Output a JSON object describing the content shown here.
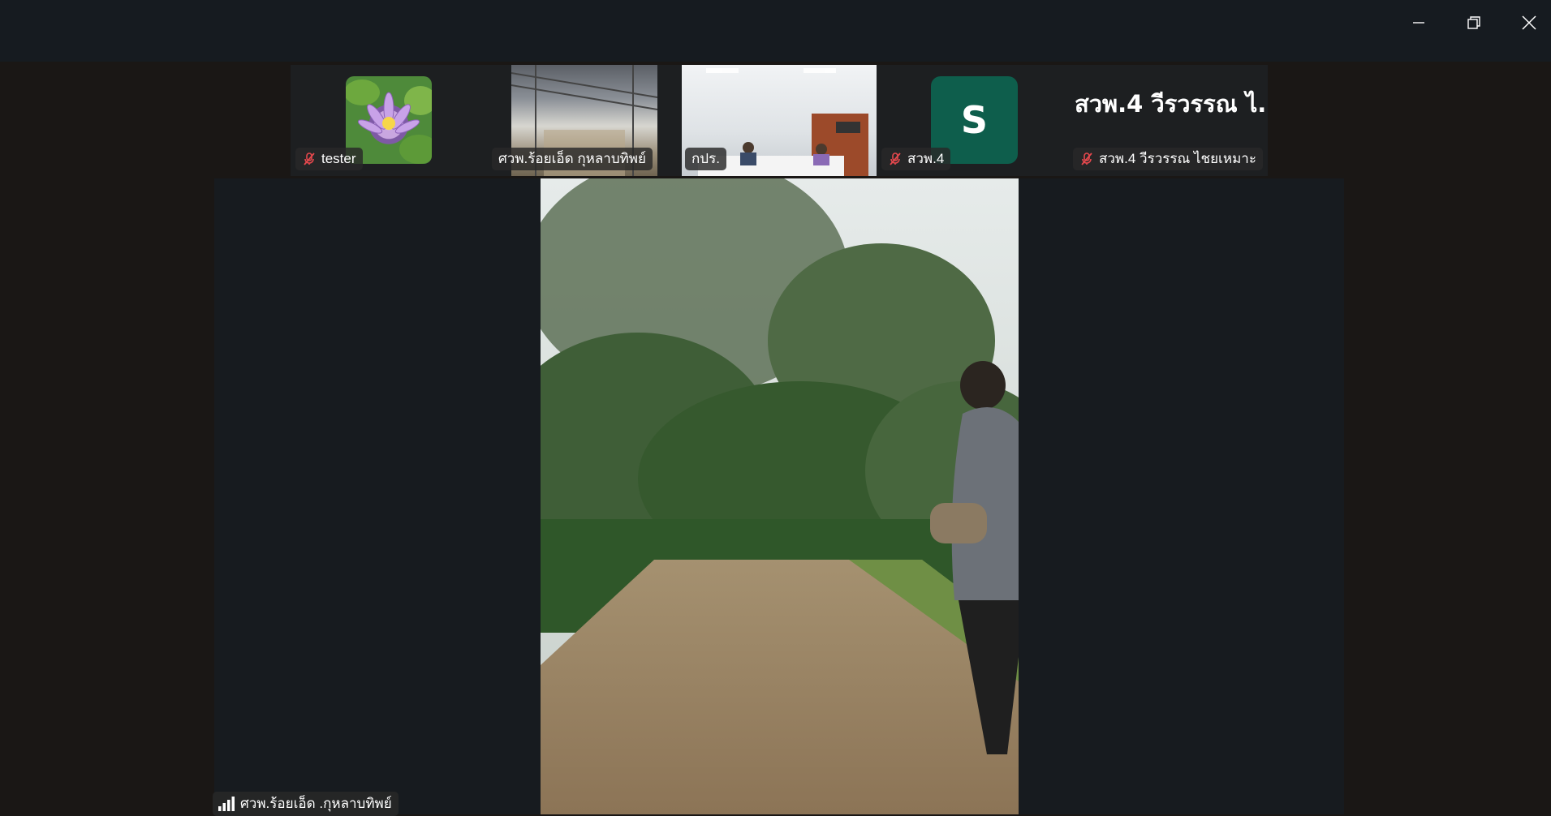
{
  "window": {
    "minimize_icon": "minimize-icon",
    "restore_icon": "restore-icon",
    "close_icon": "close-icon"
  },
  "participants": [
    {
      "name": "tester",
      "muted": true,
      "tile": "lotus-flower-photo"
    },
    {
      "name": "ศวพ.ร้อยเอ็ด กุหลาบทิพย์",
      "muted": false,
      "tile": "video"
    },
    {
      "name": "กปร.",
      "muted": false,
      "tile": "video"
    },
    {
      "name": "สวพ.4",
      "muted": true,
      "tile": "avatar",
      "avatar_letter": "S",
      "avatar_color": "#0e5e4c"
    },
    {
      "name": "สวพ.4 วีรวรรณ ไชยเหมาะ",
      "muted": true,
      "tile": "name-only",
      "display_name": "สวพ.4 วีรวรรณ ไ..."
    }
  ],
  "active_speaker": {
    "name": "ศวพ.ร้อยเอ็ด .กุหลาบทิพย์",
    "icon": "signal-bars-icon"
  },
  "colors": {
    "muted_icon": "#e5484d",
    "avatar_bg": "#0e5e4c",
    "background": "#1a1715"
  }
}
